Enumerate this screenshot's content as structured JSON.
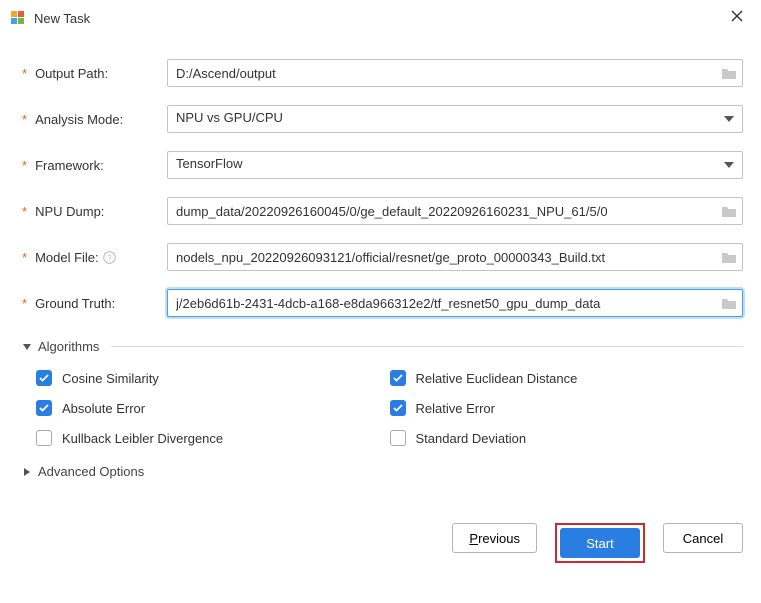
{
  "title": "New Task",
  "fields": {
    "outputPath": {
      "label": "Output Path:",
      "value": "D:/Ascend/output",
      "hasFolder": true
    },
    "analysisMode": {
      "label": "Analysis Mode:",
      "value": "NPU vs GPU/CPU"
    },
    "framework": {
      "label": "Framework:",
      "value": "TensorFlow"
    },
    "npuDump": {
      "label": "NPU Dump:",
      "value": "dump_data/20220926160045/0/ge_default_20220926160231_NPU_61/5/0",
      "hasFolder": true
    },
    "modelFile": {
      "label": "Model File:",
      "value": "nodels_npu_20220926093121/official/resnet/ge_proto_00000343_Build.txt",
      "hasFolder": true,
      "hasHelp": true
    },
    "groundTruth": {
      "label": "Ground Truth:",
      "value": "j/2eb6d61b-2431-4dcb-a168-e8da966312e2/tf_resnet50_gpu_dump_data",
      "hasFolder": true,
      "focused": true
    }
  },
  "sections": {
    "algorithms": {
      "label": "Algorithms",
      "expanded": true
    },
    "advanced": {
      "label": "Advanced Options",
      "expanded": false
    }
  },
  "algorithms": [
    {
      "label": "Cosine Similarity",
      "checked": true
    },
    {
      "label": "Relative Euclidean Distance",
      "checked": true
    },
    {
      "label": "Absolute Error",
      "checked": true
    },
    {
      "label": "Relative Error",
      "checked": true
    },
    {
      "label": "Kullback Leibler Divergence",
      "checked": false
    },
    {
      "label": "Standard Deviation",
      "checked": false
    }
  ],
  "buttons": {
    "previous": {
      "mnemonic": "P",
      "rest": "revious"
    },
    "start": "Start",
    "cancel": "Cancel"
  }
}
